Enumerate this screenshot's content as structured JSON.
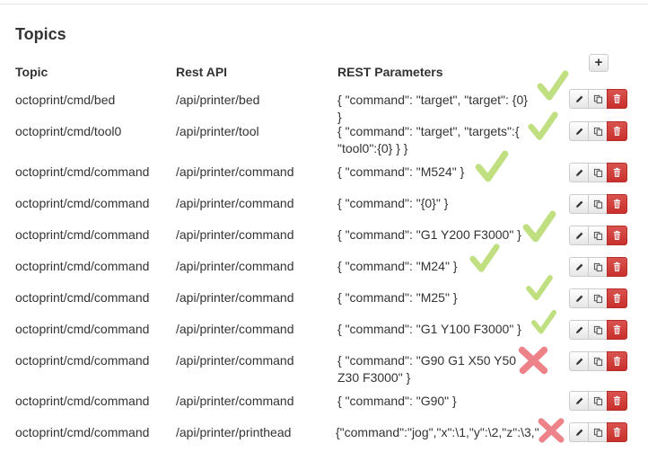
{
  "section": {
    "title": "Topics"
  },
  "headers": {
    "topic": "Topic",
    "rest_api": "Rest API",
    "rest_parameters": "REST Parameters"
  },
  "add_button": {
    "label": "+"
  },
  "rows": [
    {
      "topic": "octoprint/cmd/bed",
      "api": "/api/printer/bed",
      "params": "{ \"command\": \"target\", \"target\": {0} }",
      "mark": "check"
    },
    {
      "topic": "octoprint/cmd/tool0",
      "api": "/api/printer/tool",
      "params": "{ \"command\": \"target\", \"targets\":{ \"tool0\":{0} } }",
      "mark": "check"
    },
    {
      "topic": "octoprint/cmd/command",
      "api": "/api/printer/command",
      "params": "{ \"command\": \"M524\" }",
      "mark": "check"
    },
    {
      "topic": "octoprint/cmd/command",
      "api": "/api/printer/command",
      "params": "{ \"command\": \"{0}\" }",
      "mark": "none"
    },
    {
      "topic": "octoprint/cmd/command",
      "api": "/api/printer/command",
      "params": "{ \"command\": \"G1 Y200 F3000\" }",
      "mark": "check"
    },
    {
      "topic": "octoprint/cmd/command",
      "api": "/api/printer/command",
      "params": "{ \"command\": \"M24\" }",
      "mark": "check"
    },
    {
      "topic": "octoprint/cmd/command",
      "api": "/api/printer/command",
      "params": "{ \"command\": \"M25\" }",
      "mark": "check"
    },
    {
      "topic": "octoprint/cmd/command",
      "api": "/api/printer/command",
      "params": "{ \"command\": \"G1 Y100 F3000\" }",
      "mark": "check"
    },
    {
      "topic": "octoprint/cmd/command",
      "api": "/api/printer/command",
      "params": "{ \"command\": \"G90 G1 X50 Y50 Z30 F3000\" }",
      "mark": "cross"
    },
    {
      "topic": "octoprint/cmd/command",
      "api": "/api/printer/command",
      "params": "{ \"command\": \"G90\" }",
      "mark": "none"
    },
    {
      "topic": "octoprint/cmd/command",
      "api": "/api/printer/printhead",
      "params": "{\"command\":\"jog\",\"x\":\\1,\"y\":\\2,\"z\":\\3,\"",
      "mark": "cross"
    }
  ],
  "icons": {
    "edit": "pencil-icon",
    "copy": "copy-icon",
    "delete": "trash-icon"
  },
  "colors": {
    "check": "#b5d96a",
    "cross": "#e8636b",
    "danger": "#d9534f"
  }
}
